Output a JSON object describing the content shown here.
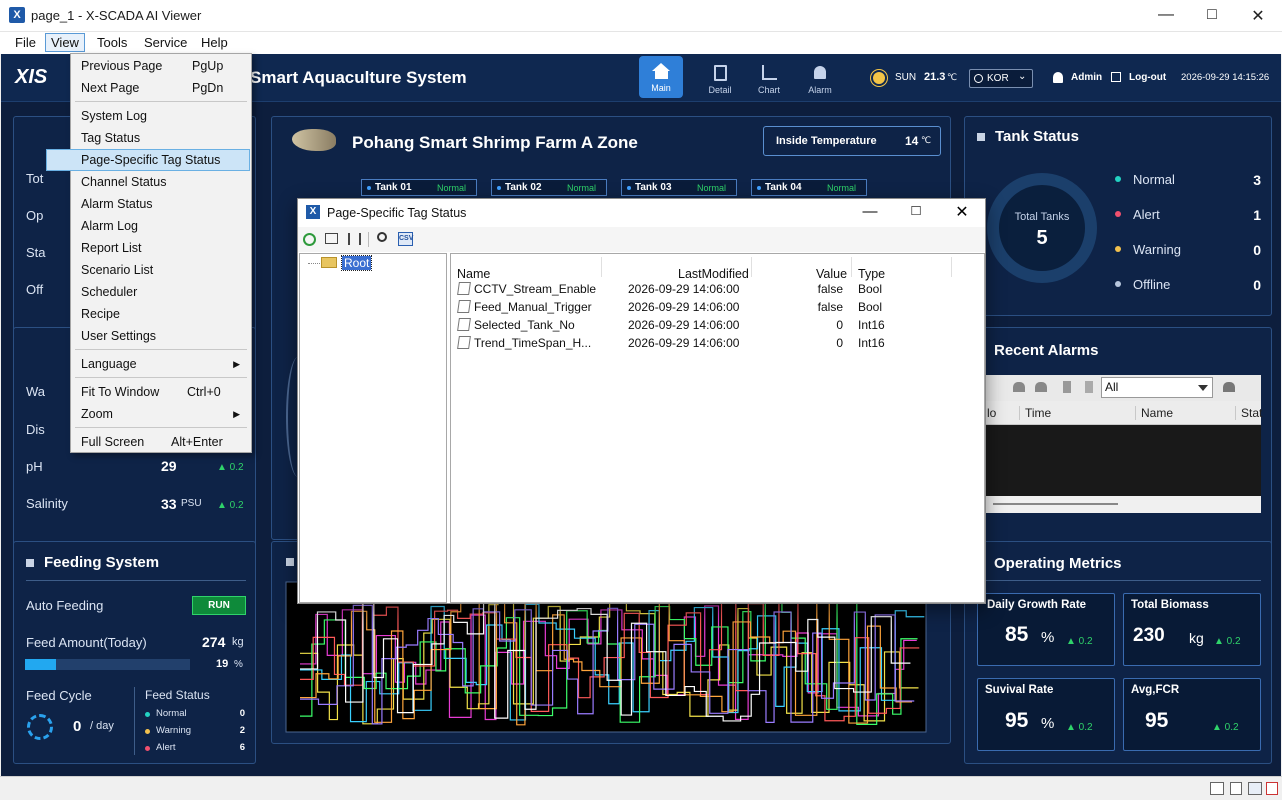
{
  "window": {
    "title": "page_1 - X-SCADA AI Viewer"
  },
  "menubar": {
    "file": "File",
    "view": "View",
    "tools": "Tools",
    "service": "Service",
    "help": "Help"
  },
  "header": {
    "logo": "XIS",
    "title": "Smart Aquaculture System",
    "nav": [
      {
        "label": "Main"
      },
      {
        "label": "Detail"
      },
      {
        "label": "Chart"
      },
      {
        "label": "Alarm"
      }
    ],
    "weather": "SUN",
    "temp": "21.3",
    "temp_unit": "℃",
    "lang": "KOR",
    "user": "Admin",
    "logout": "Log-out",
    "datetime": "2026-09-29  14:15:26"
  },
  "view_menu": {
    "items": [
      {
        "label": "Previous Page",
        "shortcut": "PgUp"
      },
      {
        "label": "Next Page",
        "shortcut": "PgDn"
      },
      {
        "label": "System Log",
        "shortcut": ""
      },
      {
        "label": "Tag Status",
        "shortcut": ""
      },
      {
        "label": "Page-Specific Tag Status",
        "shortcut": ""
      },
      {
        "label": "Channel Status",
        "shortcut": ""
      },
      {
        "label": "Alarm Status",
        "shortcut": ""
      },
      {
        "label": "Alarm Log",
        "shortcut": ""
      },
      {
        "label": "Report List",
        "shortcut": ""
      },
      {
        "label": "Scenario List",
        "shortcut": ""
      },
      {
        "label": "Scheduler",
        "shortcut": ""
      },
      {
        "label": "Recipe",
        "shortcut": ""
      },
      {
        "label": "User Settings",
        "shortcut": ""
      },
      {
        "label": "Language",
        "shortcut": ""
      },
      {
        "label": "Fit To Window",
        "shortcut": "Ctrl+0"
      },
      {
        "label": "Zoom",
        "shortcut": ""
      },
      {
        "label": "Full Screen",
        "shortcut": "Alt+Enter"
      }
    ]
  },
  "left_panel1": {
    "labels": [
      "Tot",
      "Op",
      "Sta",
      "Off"
    ]
  },
  "left_panel2": {
    "labels": [
      "Wa",
      "Dis"
    ],
    "ph_label": "pH",
    "ph_value": "29",
    "ph_delta": "▲ 0.2",
    "sal_label": "Salinity",
    "sal_value": "33",
    "sal_unit": "PSU",
    "sal_delta": "▲ 0.2"
  },
  "farm": {
    "title": "Pohang Smart Shrimp Farm A Zone",
    "inside_temp_label": "Inside Temperature",
    "inside_temp_value": "14",
    "inside_temp_unit": "℃",
    "tanks": [
      {
        "name": "Tank 01",
        "status": "Normal"
      },
      {
        "name": "Tank 02",
        "status": "Normal"
      },
      {
        "name": "Tank 03",
        "status": "Normal"
      },
      {
        "name": "Tank 04",
        "status": "Normal"
      }
    ]
  },
  "tank_status": {
    "title": "Tank Status",
    "total_label": "Total Tanks",
    "total": "5",
    "rows": [
      {
        "label": "Normal",
        "count": "3",
        "color": "#23d2c2"
      },
      {
        "label": "Alert",
        "count": "1",
        "color": "#f0506e"
      },
      {
        "label": "Warning",
        "count": "0",
        "color": "#f2c14e"
      },
      {
        "label": "Offline",
        "count": "0",
        "color": "#b7c6dd"
      }
    ]
  },
  "recent_alarms": {
    "title": "Recent Alarms",
    "filter": "All",
    "cols": [
      "lo",
      "Time",
      "Name",
      "Stat"
    ]
  },
  "feeding": {
    "title": "Feeding System",
    "auto_label": "Auto Feeding",
    "auto_state": "RUN",
    "amount_label": "Feed Amount(Today)",
    "amount_value": "274",
    "amount_unit": "kg",
    "progress_pct": 19,
    "progress_text": "19",
    "progress_unit": "%",
    "cycle_label": "Feed Cycle",
    "cycle_value": "0",
    "cycle_unit": "/ day",
    "status_label": "Feed Status",
    "status_rows": [
      {
        "label": "Normal",
        "count": "0",
        "color": "#23d2c2"
      },
      {
        "label": "Warning",
        "count": "2",
        "color": "#f2c14e"
      },
      {
        "label": "Alert",
        "count": "6",
        "color": "#f0506e"
      }
    ]
  },
  "metrics": {
    "title": "Operating Metrics",
    "items": [
      {
        "label": "Daily Growth Rate",
        "value": "85",
        "unit": "%",
        "delta": "▲ 0.2"
      },
      {
        "label": "Total Biomass",
        "value": "230",
        "unit": "kg",
        "delta": "▲ 0.2"
      },
      {
        "label": "Suvival Rate",
        "value": "95",
        "unit": "%",
        "delta": "▲ 0.2"
      },
      {
        "label": "Avg,FCR",
        "value": "95",
        "unit": "",
        "delta": "▲ 0.2"
      }
    ]
  },
  "dialog": {
    "title": "Page-Specific Tag Status",
    "tree_root": "Root",
    "columns": [
      "Name",
      "LastModified",
      "Value",
      "Type"
    ],
    "rows": [
      {
        "name": "CCTV_Stream_Enable",
        "modified": "2026-09-29 14:06:00",
        "value": "false",
        "type": "Bool"
      },
      {
        "name": "Feed_Manual_Trigger",
        "modified": "2026-09-29 14:06:00",
        "value": "false",
        "type": "Bool"
      },
      {
        "name": "Selected_Tank_No",
        "modified": "2026-09-29 14:06:00",
        "value": "0",
        "type": "Int16"
      },
      {
        "name": "Trend_TimeSpan_H...",
        "modified": "2026-09-29 14:06:00",
        "value": "0",
        "type": "Int16"
      }
    ]
  }
}
